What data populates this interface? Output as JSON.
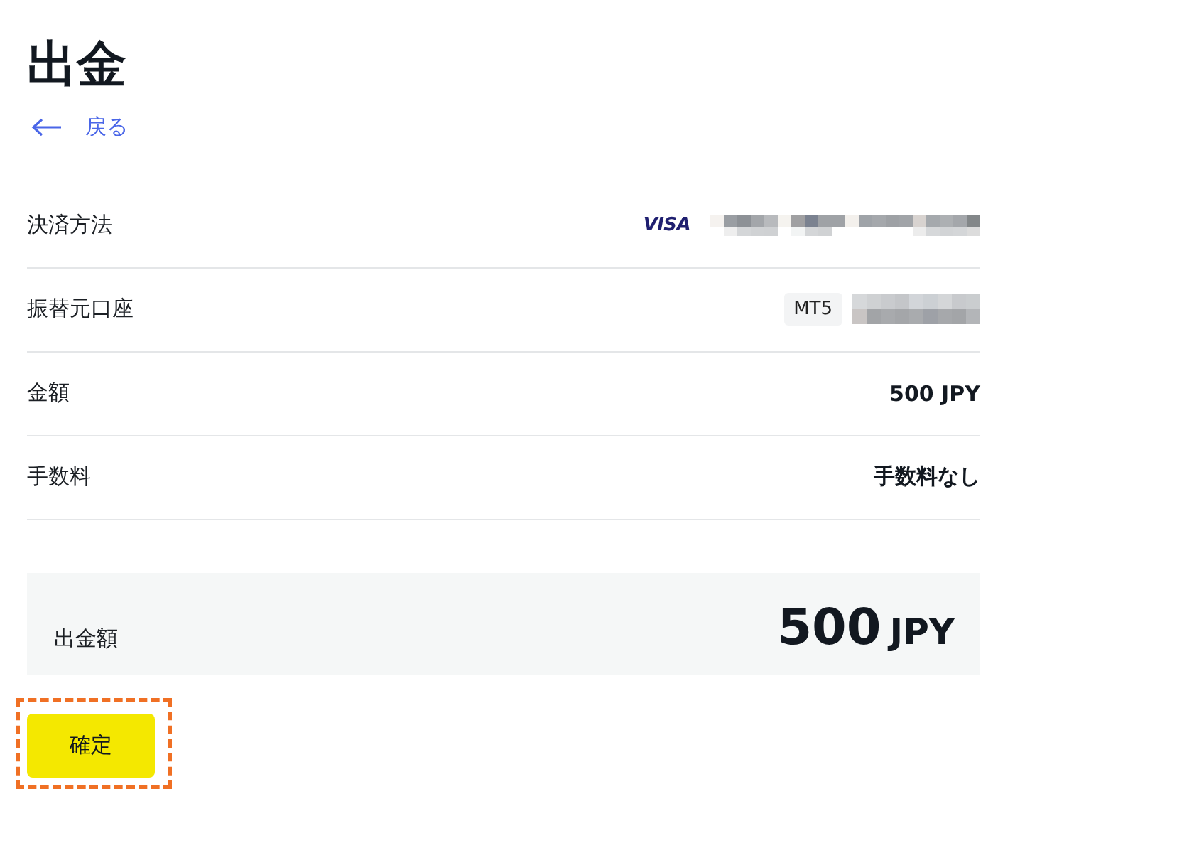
{
  "page": {
    "title": "出金",
    "back_link": {
      "label": "戻る"
    }
  },
  "details": [
    {
      "kind": "card",
      "label": "決済方法",
      "brand": "VISA"
    },
    {
      "kind": "account",
      "label": "振替元口座",
      "badge": "MT5"
    },
    {
      "kind": "text",
      "label": "金額",
      "value": "500 JPY"
    },
    {
      "kind": "text",
      "label": "手数料",
      "value": "手数料なし"
    }
  ],
  "summary": {
    "label": "出金額",
    "amount": "500",
    "currency": "JPY"
  },
  "confirm_button": {
    "label": "確定",
    "highlighted": true
  }
}
